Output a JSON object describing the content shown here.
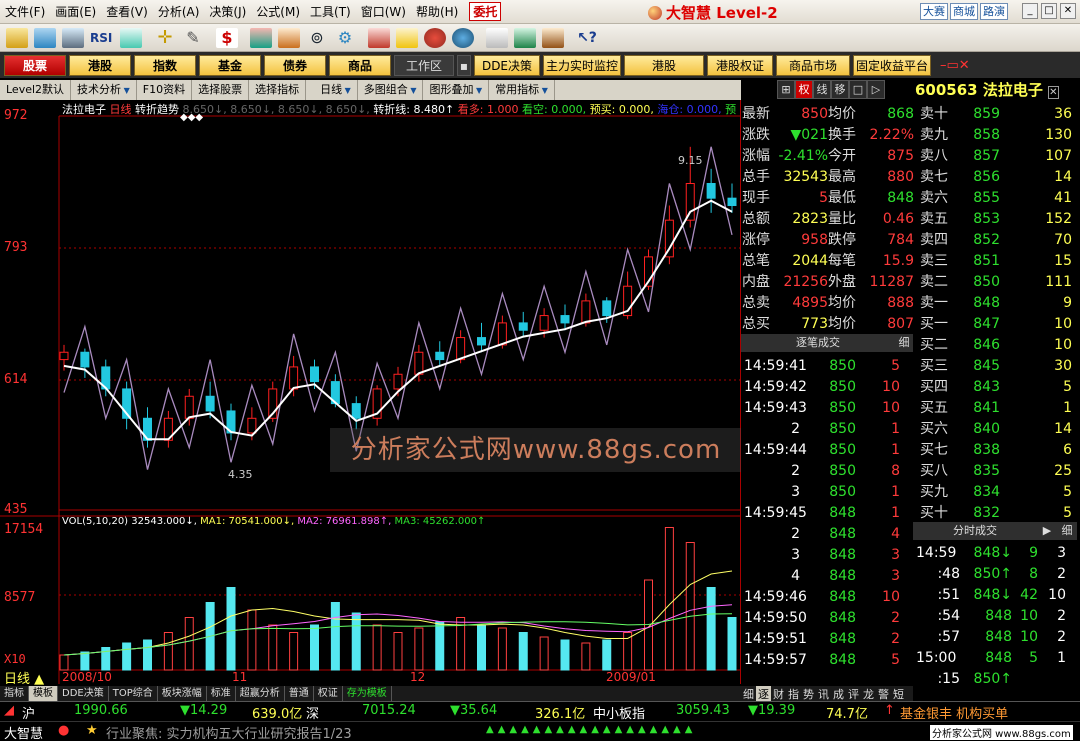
{
  "menu": {
    "items": [
      "文件(F)",
      "画面(E)",
      "查看(V)",
      "分析(A)",
      "决策(J)",
      "公式(M)",
      "工具(T)",
      "窗口(W)",
      "帮助(H)"
    ],
    "trade": "委托",
    "logo": "大智慧 Level-2",
    "right_links": [
      "大赛",
      "商城",
      "路演"
    ]
  },
  "nav": {
    "items": [
      "股票",
      "港股",
      "指数",
      "基金",
      "债券",
      "商品"
    ],
    "workarea": "工作区",
    "extra": [
      "DDE决策",
      "主力实时监控",
      "港股",
      "港股权证",
      "商品市场",
      "固定收益平台"
    ]
  },
  "subbar": {
    "items": [
      "Level2默认",
      "技术分析",
      "F10资料",
      "选择股票",
      "选择指标",
      "日线",
      "多图组合",
      "图形叠加",
      "常用指标"
    ]
  },
  "caption": {
    "stock": "法拉电子",
    "period": "日线",
    "indicator": "转折趋势",
    "vals": "8.650↓, 8.650↓, 8.650↓, 8.650↓,",
    "line_label": "转折线:",
    "line_val": "8.480↑",
    "kd": "看多:",
    "kd_val": "1.000",
    "kk": "看空:",
    "kk_val": "0.000,",
    "ym": "预买:",
    "ym_val": "0.000,",
    "hc": "海仓:",
    "hc_val": "0.000,",
    "yt": "预"
  },
  "price_axis": [
    "972",
    "793",
    "614",
    "435"
  ],
  "annotations": {
    "high": "9.15",
    "low": "4.35"
  },
  "vol_axis": [
    "17154",
    "8577",
    "X10"
  ],
  "vol_caption": {
    "name": "VOL(5,10,20)",
    "v": "32543.000↓,",
    "ma1": "MA1: 70541.000↓,",
    "ma2": "MA2: 76961.898↑,",
    "ma3": "MA3: 45262.000↑"
  },
  "date_axis": [
    "2008/10",
    "11",
    "12",
    "2009/01"
  ],
  "period_label": "日线",
  "bottom_tabs": [
    "指标",
    "模板",
    "DDE决策",
    "TOP综合",
    "板块涨幅",
    "标准",
    "超赢分析",
    "普通",
    "权证",
    "存为模板"
  ],
  "watermark": "分析家公式网www.88gs.com",
  "right": {
    "tabs": [
      "⊞",
      "权",
      "线",
      "移",
      "□",
      "▷"
    ],
    "code": "600563",
    "name": "法拉电子",
    "quote_left": [
      [
        "最新",
        "850"
      ],
      [
        "涨跌",
        "▼021"
      ],
      [
        "涨幅",
        "-2.41%"
      ],
      [
        "总手",
        "32543"
      ],
      [
        "现手",
        "5"
      ],
      [
        "总额",
        "2823"
      ],
      [
        "涨停",
        "958"
      ],
      [
        "总笔",
        "2044"
      ],
      [
        "内盘",
        "21256"
      ],
      [
        "总卖",
        "4895"
      ],
      [
        "总买",
        "773"
      ]
    ],
    "quote_right": [
      [
        "均价",
        "868"
      ],
      [
        "换手",
        "2.22%"
      ],
      [
        "今开",
        "875"
      ],
      [
        "最高",
        "880"
      ],
      [
        "最低",
        "848"
      ],
      [
        "量比",
        "0.46"
      ],
      [
        "跌停",
        "784"
      ],
      [
        "每笔",
        "15.9"
      ],
      [
        "外盘",
        "11287"
      ],
      [
        "均价",
        "888"
      ],
      [
        "均价",
        "807"
      ]
    ],
    "asks": [
      [
        "卖十",
        "859",
        "36"
      ],
      [
        "卖九",
        "858",
        "130"
      ],
      [
        "卖八",
        "857",
        "107"
      ],
      [
        "卖七",
        "856",
        "14"
      ],
      [
        "卖六",
        "855",
        "41"
      ],
      [
        "卖五",
        "853",
        "152"
      ],
      [
        "卖四",
        "852",
        "70"
      ],
      [
        "卖三",
        "851",
        "15"
      ],
      [
        "卖二",
        "850",
        "111"
      ],
      [
        "卖一",
        "848",
        "9"
      ]
    ],
    "bids": [
      [
        "买一",
        "847",
        "10"
      ],
      [
        "买二",
        "846",
        "10"
      ],
      [
        "买三",
        "845",
        "30"
      ],
      [
        "买四",
        "843",
        "5"
      ],
      [
        "买五",
        "841",
        "1"
      ],
      [
        "买六",
        "840",
        "14"
      ],
      [
        "买七",
        "838",
        "6"
      ],
      [
        "买八",
        "835",
        "25"
      ],
      [
        "买九",
        "834",
        "5"
      ],
      [
        "买十",
        "832",
        "5"
      ]
    ],
    "ticks_title": "逐笔成交",
    "ticks_btn": "细",
    "ticks": [
      [
        "14:59:41",
        "850",
        "5"
      ],
      [
        "14:59:42",
        "850",
        "10"
      ],
      [
        "14:59:43",
        "850",
        "10"
      ],
      [
        "2",
        "850",
        "1"
      ],
      [
        "14:59:44",
        "850",
        "1"
      ],
      [
        "2",
        "850",
        "8"
      ],
      [
        "3",
        "850",
        "1"
      ],
      [
        "14:59:45",
        "848",
        "1"
      ],
      [
        "2",
        "848",
        "4"
      ],
      [
        "3",
        "848",
        "3"
      ],
      [
        "4",
        "848",
        "3"
      ],
      [
        "14:59:46",
        "848",
        "10"
      ],
      [
        "14:59:50",
        "848",
        "2"
      ],
      [
        "14:59:51",
        "848",
        "2"
      ],
      [
        "14:59:57",
        "848",
        "5"
      ]
    ],
    "fs_title": "分时成交",
    "fs_btn": "细",
    "fs": [
      [
        "14:59",
        "848↓",
        "9",
        "3"
      ],
      [
        ":48",
        "850↑",
        "8",
        "2"
      ],
      [
        ":51",
        "848↓",
        "42",
        "10"
      ],
      [
        ":54",
        "848",
        "10",
        "2"
      ],
      [
        ":57",
        "848",
        "10",
        "2"
      ],
      [
        "15:00",
        "848",
        "5",
        "1"
      ],
      [
        ":15",
        "850↑",
        "",
        ""
      ]
    ],
    "lower_tabs": [
      "细",
      "逐",
      "财",
      "指",
      "势",
      "讯",
      "成",
      "评",
      "龙",
      "警",
      "短"
    ]
  },
  "status": {
    "sh": "沪",
    "sh_idx": "1990.66",
    "sh_chg": "▼14.29",
    "sh_amt": "639.0亿",
    "sz": "深",
    "sz_idx": "7015.24",
    "sz_chg": "▼35.64",
    "sz_amt": "326.1亿",
    "sme": "中小板指",
    "sme_idx": "3059.43",
    "sme_chg": "▼19.39",
    "sme_amt": "74.7亿",
    "news": "基金银丰 机构买单"
  },
  "status2": {
    "brand": "大智慧",
    "ticker": "行业聚焦: 实力机构五大行业研究报告1/23",
    "site": "分析家公式网 www.88gs.com"
  },
  "chart_data": {
    "type": "candlestick",
    "price_range": [
      435,
      972
    ],
    "candles": [
      [
        640,
        650,
        625,
        660
      ],
      [
        650,
        630,
        615,
        655
      ],
      [
        630,
        600,
        590,
        640
      ],
      [
        600,
        560,
        545,
        610
      ],
      [
        560,
        530,
        520,
        575
      ],
      [
        530,
        560,
        520,
        570
      ],
      [
        560,
        590,
        550,
        600
      ],
      [
        590,
        570,
        560,
        610
      ],
      [
        570,
        540,
        530,
        580
      ],
      [
        540,
        560,
        530,
        575
      ],
      [
        560,
        600,
        555,
        610
      ],
      [
        600,
        630,
        590,
        645
      ],
      [
        630,
        610,
        600,
        640
      ],
      [
        610,
        580,
        575,
        620
      ],
      [
        580,
        560,
        545,
        590
      ],
      [
        560,
        600,
        550,
        605
      ],
      [
        600,
        620,
        590,
        630
      ],
      [
        620,
        650,
        610,
        660
      ],
      [
        650,
        640,
        630,
        665
      ],
      [
        640,
        670,
        635,
        680
      ],
      [
        670,
        660,
        650,
        690
      ],
      [
        660,
        690,
        655,
        700
      ],
      [
        690,
        680,
        670,
        705
      ],
      [
        680,
        700,
        670,
        710
      ],
      [
        700,
        690,
        680,
        715
      ],
      [
        690,
        720,
        685,
        730
      ],
      [
        720,
        700,
        690,
        725
      ],
      [
        700,
        740,
        695,
        760
      ],
      [
        740,
        780,
        735,
        790
      ],
      [
        780,
        830,
        770,
        850
      ],
      [
        830,
        880,
        820,
        930
      ],
      [
        880,
        860,
        840,
        900
      ],
      [
        860,
        850,
        840,
        880
      ]
    ]
  }
}
